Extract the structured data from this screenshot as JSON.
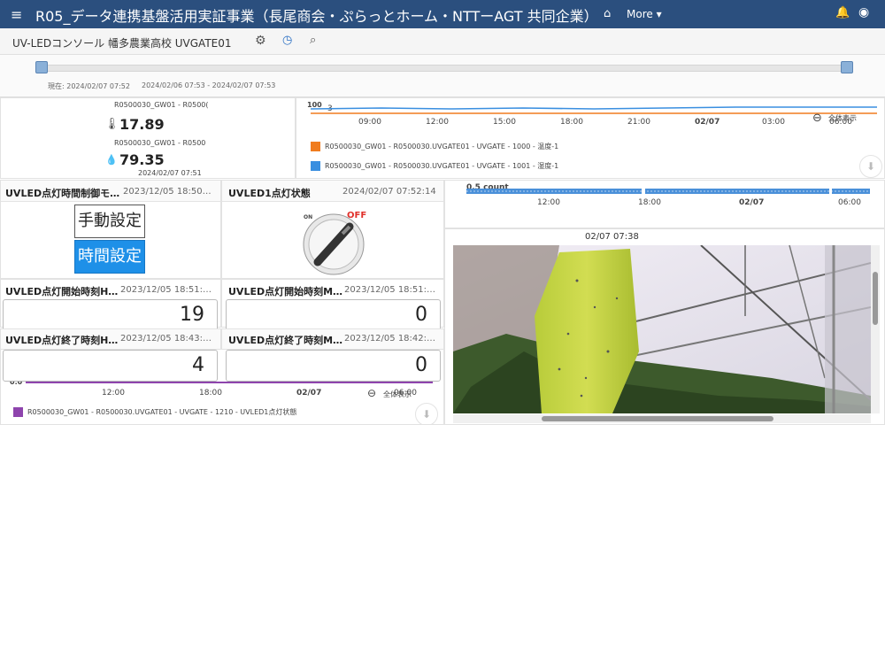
{
  "header": {
    "title": "R05_データ連携基盤活用実証事業（長尾商会・ぷらっとホーム・NTTーAGT 共同企業）",
    "more_label": "More ▾",
    "menu_glyph": "≡",
    "home_glyph": "⌂",
    "bell_glyph": "🔔",
    "user_glyph": "◉"
  },
  "subbar": {
    "device_name": "UV-LEDコンソール 幡多農業高校 UVGATE01",
    "gear_glyph": "⚙",
    "clock_glyph": "◷",
    "search_glyph": "⌕"
  },
  "timebar": {
    "current_label": "現在: 2024/02/07 07:52",
    "range_label": "2024/02/06 07:53 - 2024/02/07 07:53"
  },
  "sensors": {
    "temp_source": "R0500030_GW01 - R0500(",
    "temp_value": "17.89",
    "temp_icon": "🌡",
    "hum_source": "R0500030_GW01 - R0500",
    "hum_value": "79.35",
    "hum_icon": "💧",
    "timestamp": "2024/02/07 07:51"
  },
  "top_chart": {
    "y_top_label": "100",
    "y_bottom_label": "3",
    "ticks": [
      "09:00",
      "12:00",
      "15:00",
      "18:00",
      "21:00",
      "02/07",
      "03:00",
      "06:00"
    ],
    "zoom_label": "全体表示",
    "series": [
      {
        "name": "R0500030_GW01 - R0500030.UVGATE01 - UVGATE - 1000 - 温度-1",
        "color": "#f07c1e"
      },
      {
        "name": "R0500030_GW01 - R0500030.UVGATE01 - UVGATE - 1001 - 湿度-1",
        "color": "#3a8fe0"
      }
    ],
    "download_glyph": "⬇"
  },
  "mode_panel": {
    "title": "UVLED点灯時間制御モ…",
    "time": "2023/12/05 18:50…",
    "manual_label": "手動設定",
    "time_label": "時間設定"
  },
  "status_panel": {
    "title": "UVLED1点灯状態",
    "time": "2024/02/07 07:52:14",
    "on_label": "ON",
    "off_label": "OFF"
  },
  "start_hour": {
    "title": "UVLED点灯開始時刻H…",
    "time": "2023/12/05 18:51:…",
    "value": "19"
  },
  "start_min": {
    "title": "UVLED点灯開始時刻M…",
    "time": "2023/12/05 18:51:…",
    "value": "0"
  },
  "end_hour": {
    "title": "UVLED点灯終了時刻H…",
    "time": "2023/12/05 18:43:…",
    "value": "4"
  },
  "end_min": {
    "title": "UVLED点灯終了時刻M…",
    "time": "2023/12/05 18:42:…",
    "value": "0"
  },
  "bottom_chart": {
    "y_label": "0.0",
    "ticks": [
      "12:00",
      "18:00",
      "02/07",
      "06:00"
    ],
    "zoom_label": "全体表示",
    "series_name": "R0500030_GW01 - R0500030.UVGATE01 - UVGATE - 1210 - UVLED1点灯状態",
    "series_color": "#8e44ad"
  },
  "count_chart": {
    "y_label": "0.5 count",
    "ticks": [
      "12:00",
      "18:00",
      "02/07",
      "06:00"
    ]
  },
  "camera": {
    "timestamp": "02/07 07:38"
  }
}
